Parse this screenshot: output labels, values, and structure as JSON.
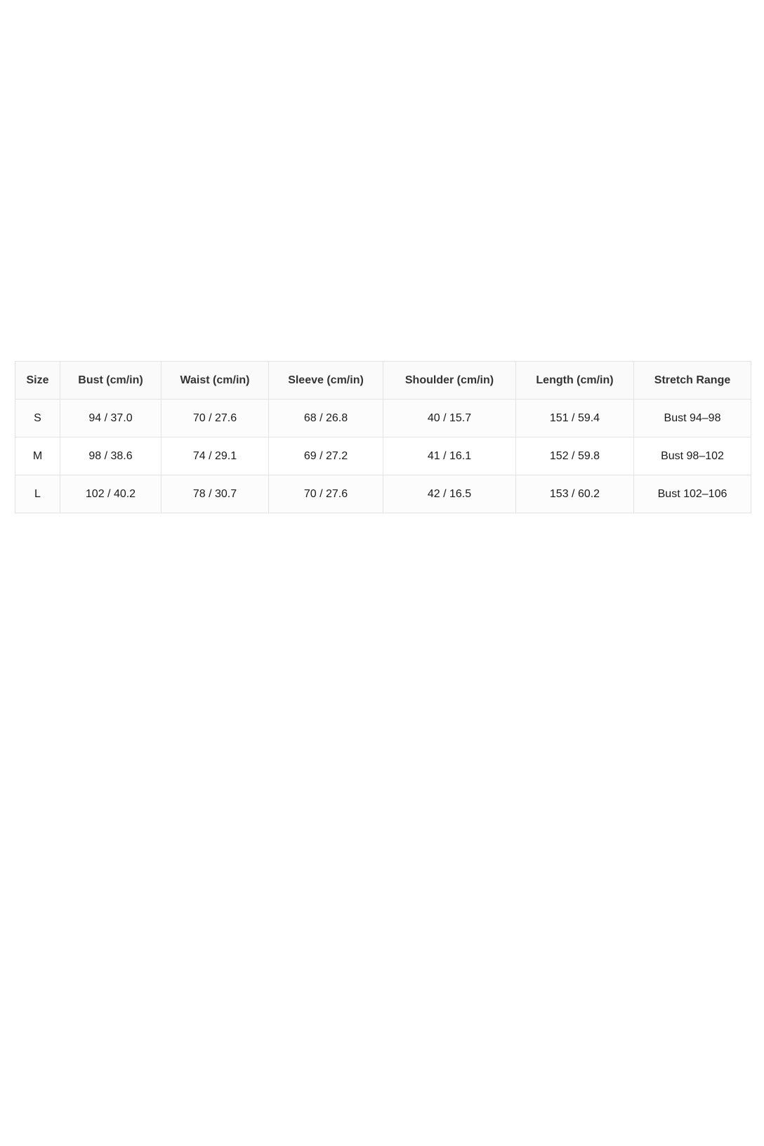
{
  "size_table": {
    "headers": [
      "Size",
      "Bust (cm/in)",
      "Waist (cm/in)",
      "Sleeve (cm/in)",
      "Shoulder (cm/in)",
      "Length (cm/in)",
      "Stretch Range"
    ],
    "rows": [
      [
        "S",
        "94 / 37.0",
        "70 / 27.6",
        "68 / 26.8",
        "40 / 15.7",
        "151 / 59.4",
        "Bust 94–98"
      ],
      [
        "M",
        "98 / 38.6",
        "74 / 29.1",
        "69 / 27.2",
        "41 / 16.1",
        "152 / 59.8",
        "Bust 98–102"
      ],
      [
        "L",
        "102 / 40.2",
        "78 / 30.7",
        "70 / 27.6",
        "42 / 16.5",
        "153 / 60.2",
        "Bust 102–106"
      ]
    ]
  }
}
